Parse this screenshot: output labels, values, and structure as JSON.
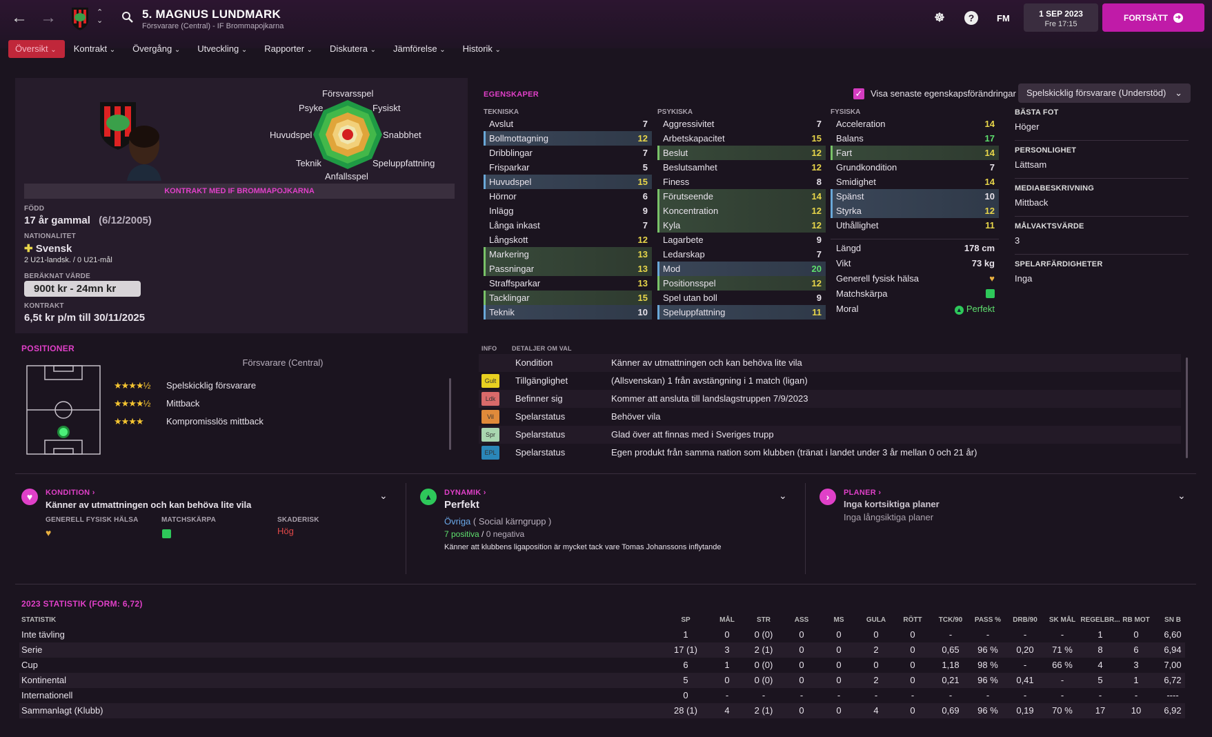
{
  "header": {
    "player_title": "5. MAGNUS LUNDMARK",
    "subtitle": "Försvarare (Central) - IF Brommapojkarna",
    "date_line1": "1 SEP 2023",
    "date_line2": "Fre 17:15",
    "continue_label": "FORTSÄTT",
    "fm_label": "FM"
  },
  "menu": [
    "Översikt",
    "Kontrakt",
    "Övergång",
    "Utveckling",
    "Rapporter",
    "Diskutera",
    "Jämförelse",
    "Historik"
  ],
  "profile": {
    "contract_banner": "KONTRAKT MED IF BROMMAPOJKARNA",
    "born_label": "FÖDD",
    "born_age": "17 år gammal",
    "born_date": "(6/12/2005)",
    "nat_label": "NATIONALITET",
    "nationality": "Svensk",
    "caps": "2 U21-landsk. / 0 U21-mål",
    "value_label": "BERÄKNAT VÄRDE",
    "value": "900t kr - 24mn kr",
    "contract_label": "KONTRAKT",
    "contract": "6,5t kr p/m till 30/11/2025"
  },
  "radar": {
    "labels": [
      "Försvarsspel",
      "Fysiskt",
      "Snabbhet",
      "Speluppfattning",
      "Anfallsspel",
      "Teknik",
      "Huvudspel",
      "Psyke"
    ]
  },
  "attributes": {
    "title": "EGENSKAPER",
    "toggle_label": "Visa senaste egenskapsförändringar",
    "role_select": "Spelskicklig försvarare (Understöd)",
    "tech_header": "TEKNISKA",
    "mental_header": "PSYKISKA",
    "phys_header": "FYSISKA",
    "technical": [
      {
        "n": "Avslut",
        "v": "7"
      },
      {
        "n": "Bollmottagning",
        "v": "12"
      },
      {
        "n": "Dribblingar",
        "v": "7"
      },
      {
        "n": "Frisparkar",
        "v": "5"
      },
      {
        "n": "Huvudspel",
        "v": "15"
      },
      {
        "n": "Hörnor",
        "v": "6"
      },
      {
        "n": "Inlägg",
        "v": "9"
      },
      {
        "n": "Långa inkast",
        "v": "7"
      },
      {
        "n": "Långskott",
        "v": "12"
      },
      {
        "n": "Markering",
        "v": "13"
      },
      {
        "n": "Passningar",
        "v": "13"
      },
      {
        "n": "Straffsparkar",
        "v": "13"
      },
      {
        "n": "Tacklingar",
        "v": "15"
      },
      {
        "n": "Teknik",
        "v": "10"
      }
    ],
    "mental": [
      {
        "n": "Aggressivitet",
        "v": "7"
      },
      {
        "n": "Arbetskapacitet",
        "v": "15"
      },
      {
        "n": "Beslut",
        "v": "12"
      },
      {
        "n": "Beslutsamhet",
        "v": "12"
      },
      {
        "n": "Finess",
        "v": "8"
      },
      {
        "n": "Förutseende",
        "v": "14"
      },
      {
        "n": "Koncentration",
        "v": "12"
      },
      {
        "n": "Kyla",
        "v": "12"
      },
      {
        "n": "Lagarbete",
        "v": "9"
      },
      {
        "n": "Ledarskap",
        "v": "7"
      },
      {
        "n": "Mod",
        "v": "20"
      },
      {
        "n": "Positionsspel",
        "v": "12"
      },
      {
        "n": "Spel utan boll",
        "v": "9"
      },
      {
        "n": "Speluppfattning",
        "v": "11"
      }
    ],
    "physical": [
      {
        "n": "Acceleration",
        "v": "14"
      },
      {
        "n": "Balans",
        "v": "17"
      },
      {
        "n": "Fart",
        "v": "14"
      },
      {
        "n": "Grundkondition",
        "v": "7"
      },
      {
        "n": "Smidighet",
        "v": "14"
      },
      {
        "n": "Spänst",
        "v": "10"
      },
      {
        "n": "Styrka",
        "v": "12"
      },
      {
        "n": "Uthållighet",
        "v": "11"
      }
    ],
    "height_label": "Längd",
    "height": "178 cm",
    "weight_label": "Vikt",
    "weight": "73 kg",
    "health_label": "Generell fysisk hälsa",
    "sharp_label": "Matchskärpa",
    "morale_label": "Moral",
    "morale": "Perfekt"
  },
  "side": {
    "foot_label": "BÄSTA FOT",
    "foot": "Höger",
    "pers_label": "PERSONLIGHET",
    "pers": "Lättsam",
    "media_label": "MEDIABESKRIVNING",
    "media": "Mittback",
    "gk_label": "MÅLVAKTSVÄRDE",
    "gk": "3",
    "skills_label": "SPELARFÄRDIGHETER",
    "skills": "Inga"
  },
  "positions": {
    "title": "POSITIONER",
    "main": "Försvarare (Central)",
    "roles": [
      {
        "stars": "★★★★½",
        "name": "Spelskicklig försvarare"
      },
      {
        "stars": "★★★★½",
        "name": "Mittback"
      },
      {
        "stars": "★★★★",
        "name": "Kompromisslös mittback"
      }
    ]
  },
  "info": {
    "h1": "INFO",
    "h2": "DETALJER OM VAL",
    "rows": [
      {
        "badge": "",
        "bc": "",
        "k": "Kondition",
        "d": "Känner av utmattningen och kan behöva lite vila"
      },
      {
        "badge": "Gult",
        "bc": "#e8d020",
        "k": "Tillgänglighet",
        "d": "(Allsvenskan) 1 från avstängning i 1 match (ligan)"
      },
      {
        "badge": "Ldk",
        "bc": "#d96a6a",
        "k": "Befinner sig",
        "d": "Kommer att ansluta till landslagstruppen 7/9/2023"
      },
      {
        "badge": "Vil",
        "bc": "#e08a3a",
        "k": "Spelarstatus",
        "d": "Behöver vila"
      },
      {
        "badge": "Spr",
        "bc": "#a9d6b0",
        "k": "Spelarstatus",
        "d": "Glad över att finnas med i Sveriges trupp"
      },
      {
        "badge": "EPL",
        "bc": "#2a86b8",
        "k": "Spelarstatus",
        "d": "Egen produkt från samma nation som klubben (tränat i landet under 3 år mellan 0 och 21 år)"
      }
    ]
  },
  "cond": {
    "title": "KONDITION ›",
    "desc": "Känner av utmattningen och kan behöva lite vila",
    "l1": "GENERELL FYSISK HÄLSA",
    "l2": "MATCHSKÄRPA",
    "l3": "SKADERISK",
    "risk": "Hög"
  },
  "dyn": {
    "title": "DYNAMIK ›",
    "val": "Perfekt",
    "group": "Övriga",
    "group_sub": "( Social kärngrupp )",
    "pos": "7 positiva",
    "sep": "/",
    "neg": "0 negativa",
    "note": "Känner att klubbens ligaposition är mycket tack vare Tomas Johanssons inflytande"
  },
  "plans": {
    "title": "PLANER ›",
    "l1": "Inga kortsiktiga planer",
    "l2": "Inga långsiktiga planer"
  },
  "stats": {
    "title": "2023 STATISTIK (FORM: 6,72)",
    "headers": [
      "STATISTIK",
      "SP",
      "MÅL",
      "STR",
      "ASS",
      "MS",
      "GULA",
      "RÖTT",
      "TCK/90",
      "PASS %",
      "DRB/90",
      "SK MÅL",
      "REGELBR...",
      "RB MOT",
      "SN B"
    ],
    "rows": [
      [
        "Inte tävling",
        "1",
        "0",
        "0 (0)",
        "0",
        "0",
        "0",
        "0",
        "-",
        "-",
        "-",
        "-",
        "1",
        "0",
        "6,60"
      ],
      [
        "Serie",
        "17 (1)",
        "3",
        "2 (1)",
        "0",
        "0",
        "2",
        "0",
        "0,65",
        "96 %",
        "0,20",
        "71 %",
        "8",
        "6",
        "6,94"
      ],
      [
        "Cup",
        "6",
        "1",
        "0 (0)",
        "0",
        "0",
        "0",
        "0",
        "1,18",
        "98 %",
        "-",
        "66 %",
        "4",
        "3",
        "7,00"
      ],
      [
        "Kontinental",
        "5",
        "0",
        "0 (0)",
        "0",
        "0",
        "2",
        "0",
        "0,21",
        "96 %",
        "0,41",
        "-",
        "5",
        "1",
        "6,72"
      ],
      [
        "Internationell",
        "0",
        "-",
        "-",
        "-",
        "-",
        "-",
        "-",
        "-",
        "-",
        "-",
        "-",
        "-",
        "-",
        "----"
      ],
      [
        "Sammanlagt (Klubb)",
        "28 (1)",
        "4",
        "2 (1)",
        "0",
        "0",
        "4",
        "0",
        "0,69",
        "96 %",
        "0,19",
        "70 %",
        "17",
        "10",
        "6,92"
      ]
    ]
  }
}
